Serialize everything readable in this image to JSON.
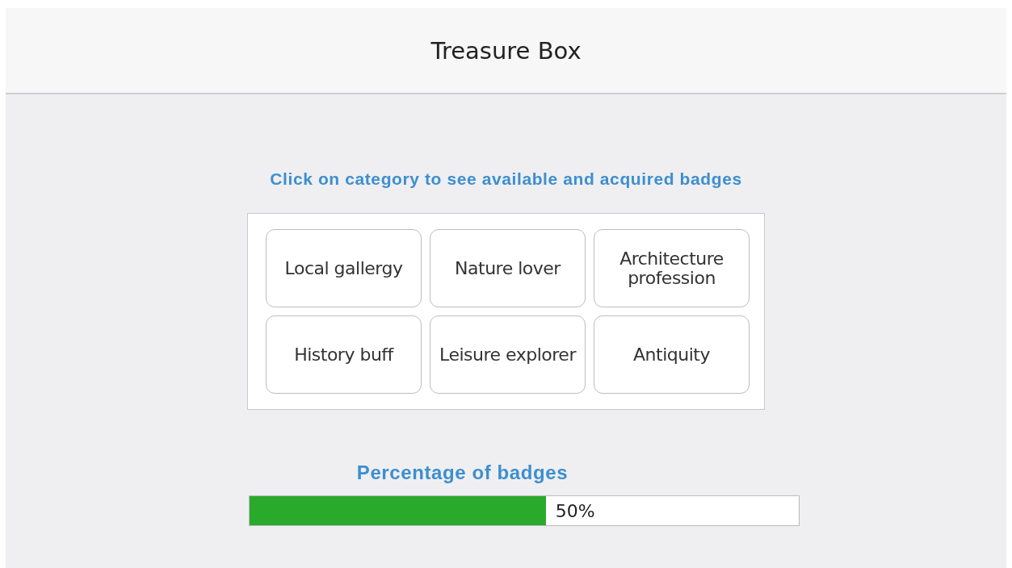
{
  "header": {
    "title": "Treasure Box"
  },
  "instruction": "Click on category to see available and acquired badges",
  "categories": [
    {
      "label": "Local gallergy"
    },
    {
      "label": "Nature lover"
    },
    {
      "label": "Architecture profession"
    },
    {
      "label": "History buff"
    },
    {
      "label": "Leisure explorer"
    },
    {
      "label": "Antiquity"
    }
  ],
  "progress": {
    "label": "Percentage of badges",
    "level": 0.54,
    "reading": "50%"
  }
}
